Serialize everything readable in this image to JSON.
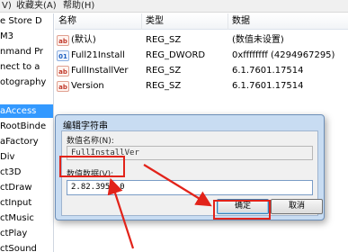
{
  "menubar": {
    "left_text": "Ⅴ)",
    "items": [
      "收藏夹(A)",
      "帮助(H)"
    ]
  },
  "tree": {
    "items": [
      {
        "label": "e Store D"
      },
      {
        "label": "M3"
      },
      {
        "label": "nmand Pr"
      },
      {
        "label": "nect to a"
      },
      {
        "label": "otography"
      },
      {
        "label": "aAccess"
      },
      {
        "label": "RootBinde"
      },
      {
        "label": "aFactory"
      },
      {
        "label": "Div"
      },
      {
        "label": "ct3D"
      },
      {
        "label": "ctDraw"
      },
      {
        "label": "ctInput"
      },
      {
        "label": "ctMusic"
      },
      {
        "label": "ctPlay"
      },
      {
        "label": "ctSound"
      }
    ]
  },
  "list": {
    "headers": [
      "名称",
      "类型",
      "数据"
    ],
    "rows": [
      {
        "icon": "string-value-icon",
        "name": "(默认)",
        "type": "REG_SZ",
        "data": "(数值未设置)"
      },
      {
        "icon": "dword-value-icon",
        "name": "Full21Install",
        "type": "REG_DWORD",
        "data": "0xffffffff (4294967295)"
      },
      {
        "icon": "string-value-icon",
        "name": "FullInstallVer",
        "type": "REG_SZ",
        "data": "6.1.7601.17514"
      },
      {
        "icon": "string-value-icon",
        "name": "Version",
        "type": "REG_SZ",
        "data": "6.1.7601.17514"
      }
    ]
  },
  "dialog": {
    "title": "编辑字符串",
    "name_label": "数值名称(N):",
    "name_value": "FullInstallVer",
    "data_label": "数值数据(V):",
    "data_value": "2.82.3959.0",
    "ok_label": "确定",
    "cancel_label": "取消"
  },
  "accent_colors": {
    "annotation": "#e2231a",
    "selection": "#3399ff"
  }
}
